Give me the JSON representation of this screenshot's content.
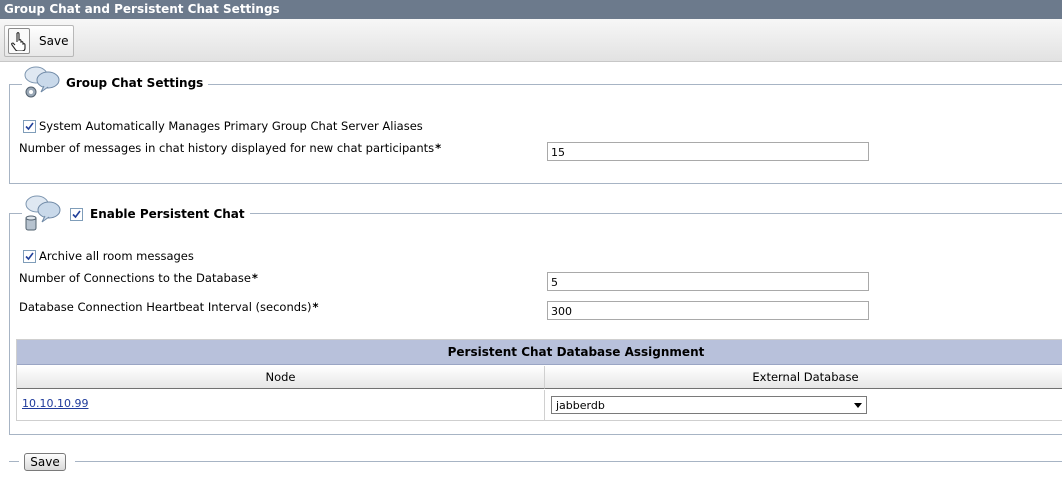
{
  "page": {
    "title": "Group Chat and Persistent Chat Settings"
  },
  "toolbar": {
    "save_label": "Save",
    "save_icon": "save-icon"
  },
  "group_chat": {
    "legend": "Group Chat Settings",
    "icon": "chat-bubbles-gear-icon",
    "auto_manage_label": "System Automatically Manages Primary Group Chat Server Aliases",
    "auto_manage_checked": true,
    "history_label": "Number of messages in chat history displayed for new chat participants",
    "history_value": "15",
    "required_mark": "*"
  },
  "persistent_chat": {
    "legend": "Enable Persistent Chat",
    "icon": "chat-bubbles-database-icon",
    "enabled": true,
    "archive_label": "Archive all room messages",
    "archive_checked": true,
    "connections_label": "Number of Connections to the Database",
    "connections_value": "5",
    "heartbeat_label": "Database Connection Heartbeat Interval (seconds)",
    "heartbeat_value": "300",
    "required_mark": "*"
  },
  "db_assignment": {
    "title": "Persistent Chat Database Assignment",
    "columns": [
      "Node",
      "External Database"
    ],
    "rows": [
      {
        "node": "10.10.10.99",
        "external_db": "jabberdb"
      }
    ]
  },
  "bottom": {
    "save_label": "Save"
  },
  "colors": {
    "titlebar": "#6c7a8c",
    "table_header": "#b8c1db",
    "link": "#1f3b9b",
    "fieldset_border": "#a7b4c4"
  }
}
